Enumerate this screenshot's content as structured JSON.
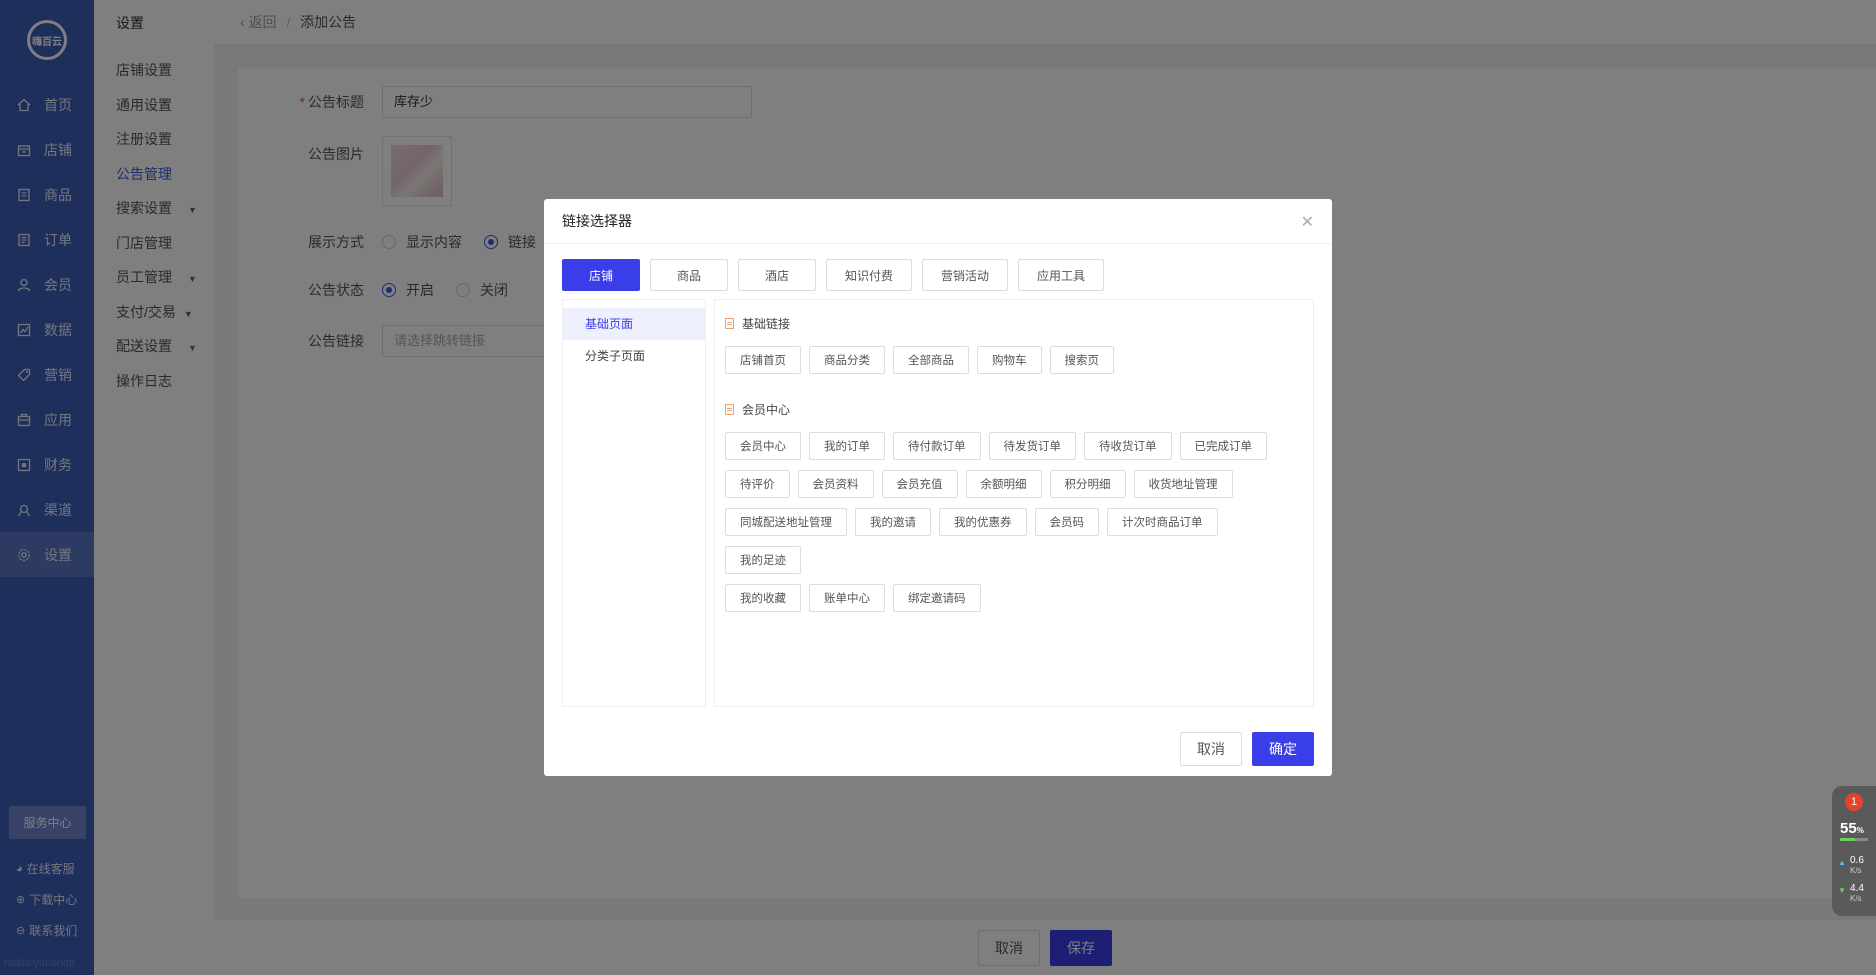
{
  "sidebar": {
    "logo": "嗨百云",
    "items": [
      {
        "label": "首页",
        "icon": "home-icon"
      },
      {
        "label": "店铺",
        "icon": "shop-icon"
      },
      {
        "label": "商品",
        "icon": "goods-icon"
      },
      {
        "label": "订单",
        "icon": "order-icon"
      },
      {
        "label": "会员",
        "icon": "user-icon"
      },
      {
        "label": "数据",
        "icon": "chart-icon"
      },
      {
        "label": "营销",
        "icon": "tag-icon"
      },
      {
        "label": "应用",
        "icon": "app-icon"
      },
      {
        "label": "财务",
        "icon": "finance-icon"
      },
      {
        "label": "渠道",
        "icon": "channel-icon"
      },
      {
        "label": "设置",
        "icon": "gear-icon",
        "active": true
      }
    ],
    "service_center": "服务中心",
    "links": [
      "在线客服",
      "下载中心",
      "联系我们"
    ],
    "watermark": "haibaiyunshop"
  },
  "submenu": {
    "title": "设置",
    "items": [
      {
        "label": "店铺设置"
      },
      {
        "label": "通用设置"
      },
      {
        "label": "注册设置"
      },
      {
        "label": "公告管理",
        "active": true
      },
      {
        "label": "搜索设置",
        "caret": true
      },
      {
        "label": "门店管理"
      },
      {
        "label": "员工管理",
        "caret": true
      },
      {
        "label": "支付/交易",
        "caret": true
      },
      {
        "label": "配送设置",
        "caret": true
      },
      {
        "label": "操作日志"
      }
    ]
  },
  "topbar": {
    "back": "返回",
    "separator": "/",
    "crumb": "添加公告"
  },
  "form": {
    "title_label": "公告标题",
    "title_value": "库存少",
    "image_label": "公告图片",
    "display_label": "展示方式",
    "display_options": [
      "显示内容",
      "链接"
    ],
    "status_label": "公告状态",
    "status_options": [
      "开启",
      "关闭"
    ],
    "link_label": "公告链接",
    "link_placeholder": "请选择跳转链接"
  },
  "footer": {
    "cancel": "取消",
    "save": "保存"
  },
  "modal": {
    "title": "链接选择器",
    "tabs": [
      "店铺",
      "商品",
      "酒店",
      "知识付费",
      "营销活动",
      "应用工具"
    ],
    "left_items": [
      "基础页面",
      "分类子页面"
    ],
    "sections": [
      {
        "title": "基础链接",
        "chips": [
          "店铺首页",
          "商品分类",
          "全部商品",
          "购物车",
          "搜索页"
        ]
      },
      {
        "title": "会员中心",
        "chips": [
          "会员中心",
          "我的订单",
          "待付款订单",
          "待发货订单",
          "待收货订单",
          "已完成订单",
          "待评价",
          "会员资料",
          "会员充值",
          "余额明细",
          "积分明细",
          "收货地址管理",
          "同城配送地址管理",
          "我的邀请",
          "我的优惠券",
          "会员码",
          "计次时商品订单",
          "我的足迹",
          "我的收藏",
          "账单中心",
          "绑定邀请码"
        ]
      }
    ],
    "cancel": "取消",
    "confirm": "确定"
  },
  "monitor": {
    "badge": "1",
    "cpu": "55",
    "cpu_unit": "%",
    "cpu_fraction": 0.55,
    "up": "0.6",
    "down": "4.4",
    "unit": "K/s"
  },
  "colors": {
    "sidebar": "#3f5eb8",
    "primary": "#3a3ee8",
    "accent_text": "#3a5ad8"
  }
}
